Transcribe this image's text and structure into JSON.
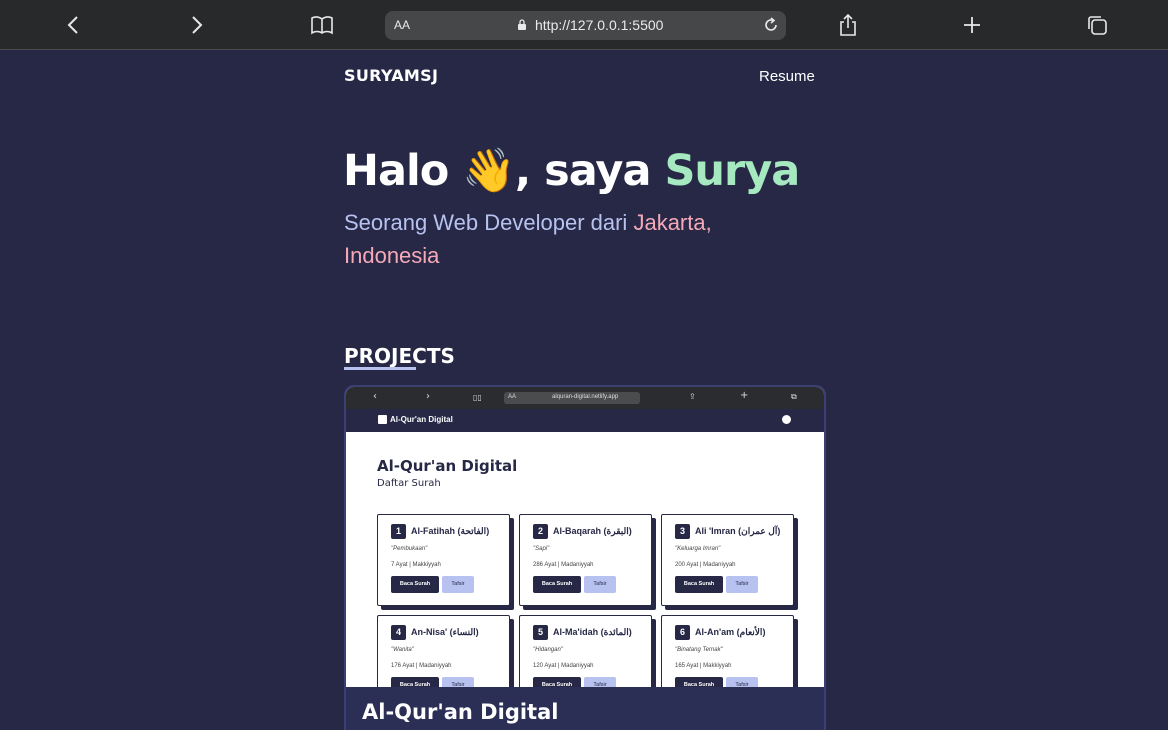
{
  "browser": {
    "text_size_label": "AA",
    "url": "http://127.0.0.1:5500"
  },
  "nav": {
    "brand": "SURYAMSJ",
    "resume": "Resume"
  },
  "hero": {
    "greeting": "Halo",
    "wave": "👋",
    "intro": ", saya",
    "name": "Surya",
    "subtitle_prefix": "Seorang Web Developer dari",
    "location": "Jakarta, Indonesia"
  },
  "section": {
    "title": "PROJECTS"
  },
  "project": {
    "title": "Al-Qur'an Digital",
    "screenshot": {
      "url": "alquran-digital.netlify.app",
      "text_size_label": "AA",
      "app_name": "Al-Qur'an Digital",
      "page_title": "Al-Qur'an Digital",
      "page_subtitle": "Daftar Surah",
      "surahs": [
        {
          "num": "1",
          "name": "Al-Fatihah (الفاتحة)",
          "meaning": "\"Pembukaan\"",
          "info": "7 Ayat | Makkiyyah",
          "read": "Baca Surah",
          "tafsir": "Tafsir"
        },
        {
          "num": "2",
          "name": "Al-Baqarah (البقرة)",
          "meaning": "\"Sapi\"",
          "info": "286 Ayat | Madaniyyah",
          "read": "Baca Surah",
          "tafsir": "Tafsir"
        },
        {
          "num": "3",
          "name": "Ali 'Imran (آل عمران)",
          "meaning": "\"Keluarga Imran\"",
          "info": "200 Ayat | Madaniyyah",
          "read": "Baca Surah",
          "tafsir": "Tafsir"
        },
        {
          "num": "4",
          "name": "An-Nisa' (النساء)",
          "meaning": "\"Wanita\"",
          "info": "176 Ayat | Madaniyyah",
          "read": "Baca Surah",
          "tafsir": "Tafsir"
        },
        {
          "num": "5",
          "name": "Al-Ma'idah (المائدة)",
          "meaning": "\"Hidangan\"",
          "info": "120 Ayat | Madaniyyah",
          "read": "Baca Surah",
          "tafsir": "Tafsir"
        },
        {
          "num": "6",
          "name": "Al-An'am (الأنعام)",
          "meaning": "\"Binatang Ternak\"",
          "info": "165 Ayat | Makkiyyah",
          "read": "Baca Surah",
          "tafsir": "Tafsir"
        }
      ]
    }
  },
  "colors": {
    "page_bg": "#262846",
    "accent_green": "#a6e8c0",
    "accent_lavender": "#b8c2f0",
    "accent_pink": "#f5a9b8"
  }
}
